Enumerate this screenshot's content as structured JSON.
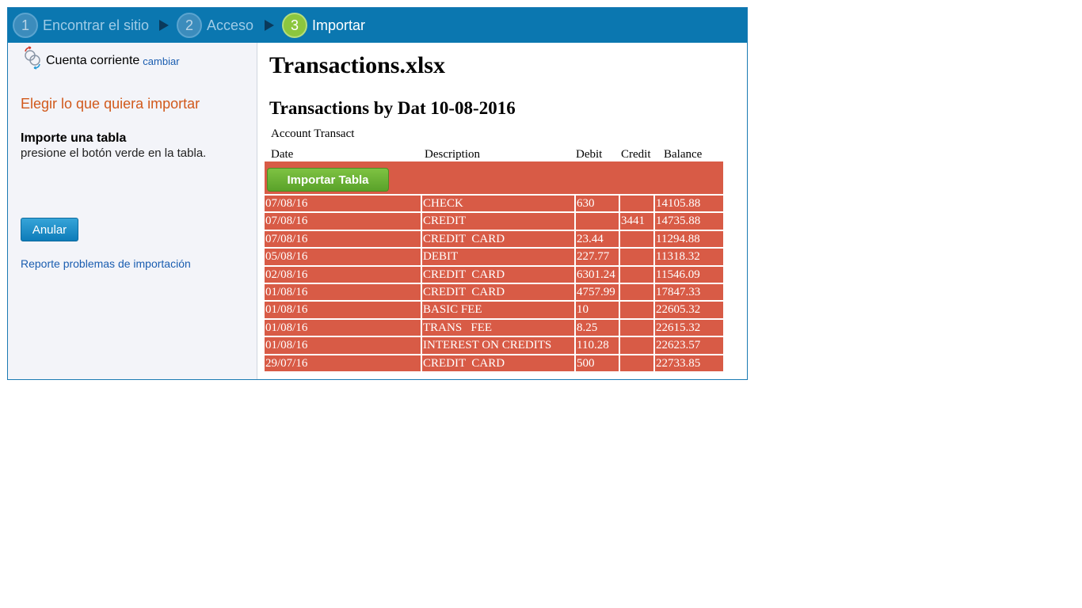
{
  "wizard": {
    "steps": [
      {
        "number": "1",
        "label": "Encontrar el sitio"
      },
      {
        "number": "2",
        "label": "Acceso"
      },
      {
        "number": "3",
        "label": "Importar"
      }
    ],
    "active_step": 3
  },
  "sidebar": {
    "account_name": "Cuenta corriente",
    "change_link": "cambiar",
    "choose_title": "Elegir lo que quiera importar",
    "import_heading": "Importe una tabla",
    "import_hint": "presione el botón verde en la tabla.",
    "cancel_button": "Anular",
    "report_link": "Reporte problemas de importación"
  },
  "main": {
    "file_title": "Transactions.xlsx",
    "table_title": "Transactions by Dat 10-08-2016",
    "account_label": "Account Transact",
    "columns": [
      "Date",
      "Description",
      "Debit",
      "Credit",
      "Balance"
    ],
    "import_table_button": "Importar Tabla",
    "rows": [
      [
        "07/08/16",
        "CHECK",
        "630",
        "",
        "14105.88"
      ],
      [
        "07/08/16",
        "CREDIT",
        "",
        "3441",
        "14735.88"
      ],
      [
        "07/08/16",
        "CREDIT  CARD",
        "23.44",
        "",
        "11294.88"
      ],
      [
        "05/08/16",
        "DEBIT",
        "227.77",
        "",
        "11318.32"
      ],
      [
        "02/08/16",
        "CREDIT  CARD",
        "6301.24",
        "",
        "11546.09"
      ],
      [
        "01/08/16",
        "CREDIT  CARD",
        "4757.99",
        "",
        "17847.33"
      ],
      [
        "01/08/16",
        "BASIC FEE",
        "10",
        "",
        "22605.32"
      ],
      [
        "01/08/16",
        "TRANS   FEE",
        "8.25",
        "",
        "22615.32"
      ],
      [
        "01/08/16",
        "INTEREST ON CREDITS",
        "110.28",
        "",
        "22623.57"
      ],
      [
        "29/07/16",
        "CREDIT  CARD",
        "500",
        "",
        "22733.85"
      ]
    ]
  },
  "colors": {
    "wizard_bg": "#0b77b0",
    "active_step": "#8cc63e",
    "table_row": "#d85b46",
    "accent_orange": "#d1591b",
    "link_blue": "#1a5db0"
  }
}
